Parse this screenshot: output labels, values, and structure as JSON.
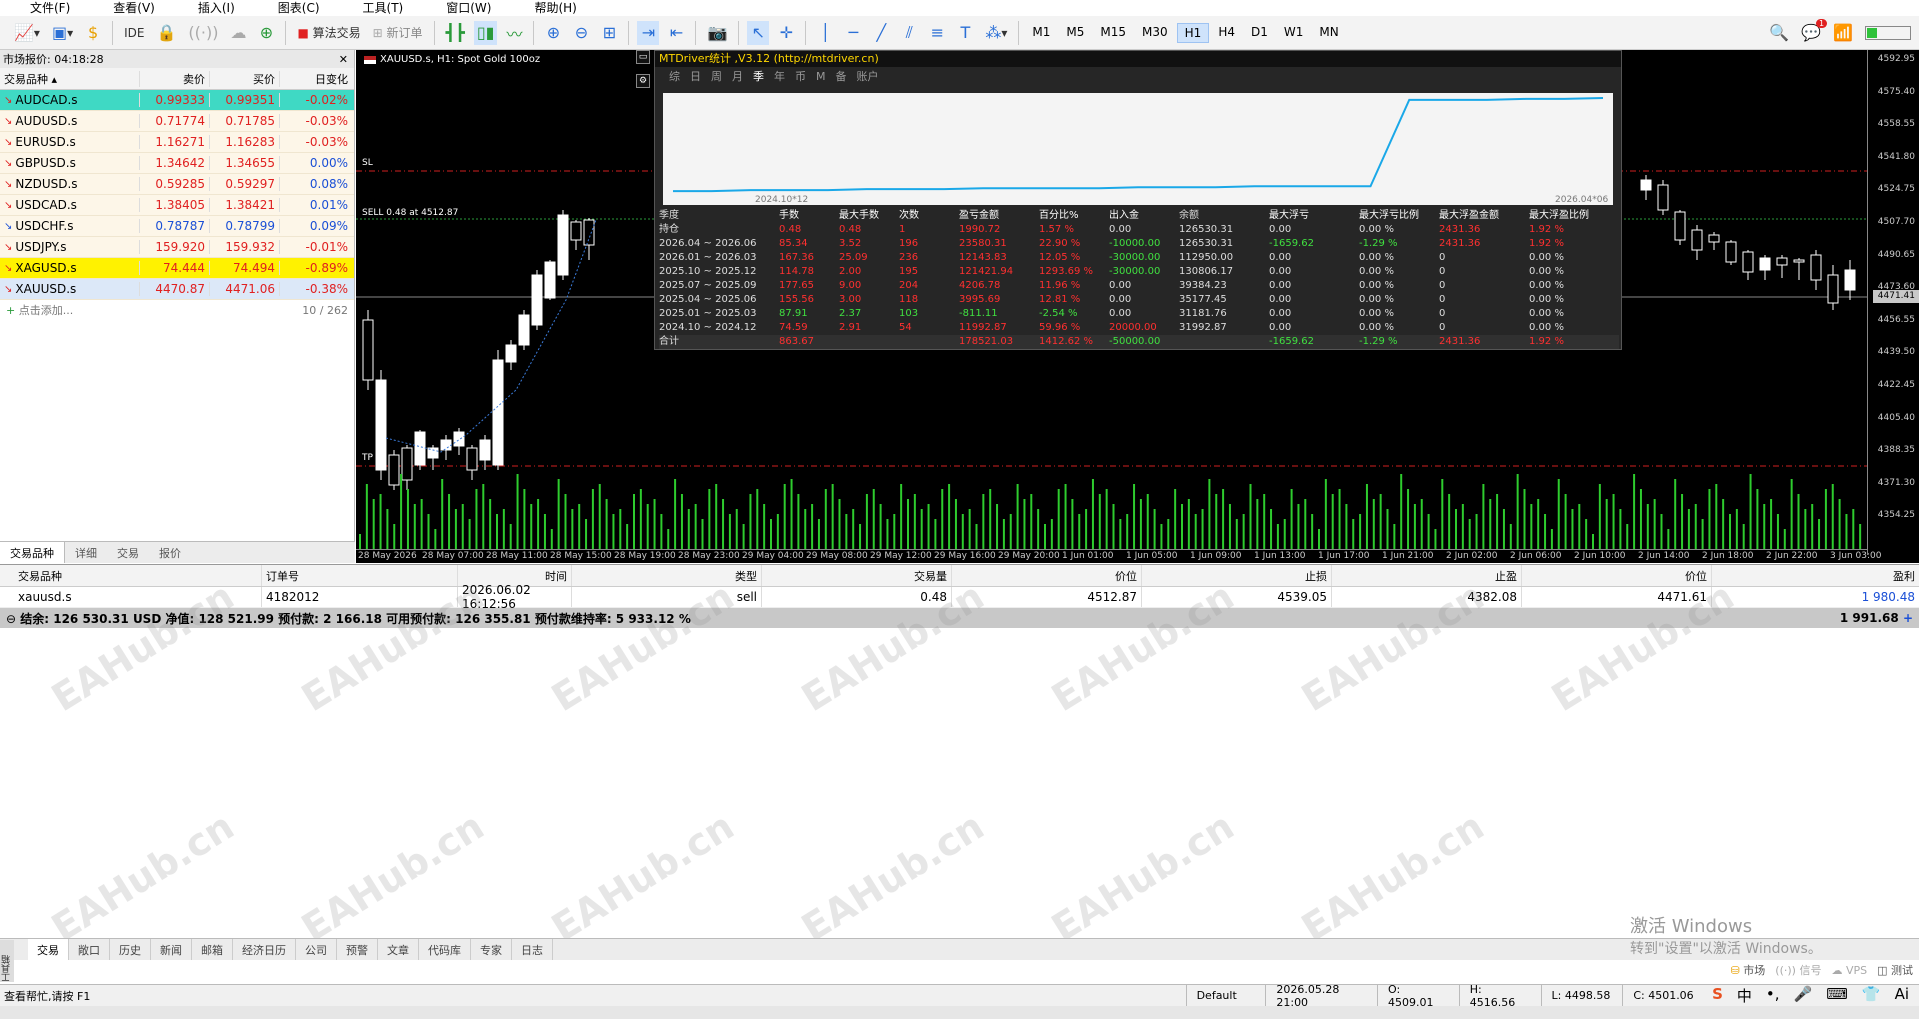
{
  "menu": [
    "文件(F)",
    "查看(V)",
    "插入(I)",
    "图表(C)",
    "工具(T)",
    "窗口(W)",
    "帮助(H)"
  ],
  "toolbar": {
    "ide": "IDE",
    "algo": "算法交易",
    "new_order": "新订单",
    "timeframes": [
      "M1",
      "M5",
      "M15",
      "M30",
      "H1",
      "H4",
      "D1",
      "W1",
      "MN"
    ],
    "active_tf": "H1"
  },
  "market_watch": {
    "title": "市场报价: 04:18:28",
    "cols": [
      "交易品种",
      "卖价",
      "买价",
      "日变化"
    ],
    "rows": [
      {
        "sym": "AUDCAD.s",
        "bid": "0.99333",
        "ask": "0.99351",
        "chg": "-0.02%",
        "dir": "dn",
        "sel": "sel1"
      },
      {
        "sym": "AUDUSD.s",
        "bid": "0.71774",
        "ask": "0.71785",
        "chg": "-0.03%",
        "dir": "dn",
        "sel": ""
      },
      {
        "sym": "EURUSD.s",
        "bid": "1.16271",
        "ask": "1.16283",
        "chg": "-0.03%",
        "dir": "dn",
        "sel": ""
      },
      {
        "sym": "GBPUSD.s",
        "bid": "1.34642",
        "ask": "1.34655",
        "chg": "0.00%",
        "dir": "dn",
        "sel": ""
      },
      {
        "sym": "NZDUSD.s",
        "bid": "0.59285",
        "ask": "0.59297",
        "chg": "0.08%",
        "dir": "dn",
        "sel": ""
      },
      {
        "sym": "USDCAD.s",
        "bid": "1.38405",
        "ask": "1.38421",
        "chg": "0.01%",
        "dir": "dn",
        "sel": ""
      },
      {
        "sym": "USDCHF.s",
        "bid": "0.78787",
        "ask": "0.78799",
        "chg": "0.09%",
        "dir": "up",
        "sel": ""
      },
      {
        "sym": "USDJPY.s",
        "bid": "159.920",
        "ask": "159.932",
        "chg": "-0.01%",
        "dir": "dn",
        "sel": ""
      },
      {
        "sym": "XAGUSD.s",
        "bid": "74.444",
        "ask": "74.494",
        "chg": "-0.89%",
        "dir": "dn",
        "sel": "sel2"
      },
      {
        "sym": "XAUUSD.s",
        "bid": "4470.87",
        "ask": "4471.06",
        "chg": "-0.38%",
        "dir": "dn",
        "sel": "sel3"
      }
    ],
    "add": "点击添加...",
    "count": "10 / 262",
    "tabs": [
      "交易品种",
      "详细",
      "交易",
      "报价"
    ]
  },
  "chart": {
    "title": "XAUUSD.s, H1:  Spot Gold 100oz",
    "sl_label": "SL",
    "tp_label": "TP",
    "sell_label": "SELL 0.48 at 4512.87",
    "y_labels": [
      "4592.95",
      "4575.40",
      "4558.55",
      "4541.80",
      "4524.75",
      "4507.70",
      "4490.65",
      "4473.60",
      "4456.55",
      "4439.50",
      "4422.45",
      "4405.40",
      "4388.35",
      "4371.30",
      "4354.25"
    ],
    "current_price": "4471.41",
    "x_labels": [
      "28 May 2026",
      "28 May 07:00",
      "28 May 11:00",
      "28 May 15:00",
      "28 May 19:00",
      "28 May 23:00",
      "29 May 04:00",
      "29 May 08:00",
      "29 May 12:00",
      "29 May 16:00",
      "29 May 20:00",
      "1 Jun 01:00",
      "1 Jun 05:00",
      "1 Jun 09:00",
      "1 Jun 13:00",
      "1 Jun 17:00",
      "1 Jun 21:00",
      "2 Jun 02:00",
      "2 Jun 06:00",
      "2 Jun 10:00",
      "2 Jun 14:00",
      "2 Jun 18:00",
      "2 Jun 22:00",
      "3 Jun 03:00"
    ]
  },
  "mtd": {
    "title": "MTDriver统计 ,V3.12 (http://mtdriver.cn)",
    "tabs": [
      "综",
      "日",
      "周",
      "月",
      "季",
      "年",
      "币",
      "M",
      "备",
      "账户"
    ],
    "active_tab": "季",
    "date_start": "2024.10*12",
    "date_end": "2026.04*06",
    "headers": [
      "季度",
      "手数",
      "最大手数",
      "次数",
      "盈亏金额",
      "百分比%",
      "出入金",
      "余额",
      "最大浮亏",
      "最大浮亏比例",
      "最大浮盈金额",
      "最大浮盈比例"
    ],
    "rows": [
      [
        "持仓",
        "0.48",
        "0.48",
        "1",
        "1990.72",
        "1.57 %",
        "0.00",
        "126530.31",
        "0.00",
        "0.00 %",
        "2431.36",
        "1.92 %"
      ],
      [
        "2026.04 ~ 2026.06",
        "85.34",
        "3.52",
        "196",
        "23580.31",
        "22.90 %",
        "-10000.00",
        "126530.31",
        "-1659.62",
        "-1.29 %",
        "2431.36",
        "1.92 %"
      ],
      [
        "2026.01 ~ 2026.03",
        "167.36",
        "25.09",
        "236",
        "12143.83",
        "12.05 %",
        "-30000.00",
        "112950.00",
        "0.00",
        "0.00 %",
        "0",
        "0.00 %"
      ],
      [
        "2025.10 ~ 2025.12",
        "114.78",
        "2.00",
        "195",
        "121421.94",
        "1293.69 %",
        "-30000.00",
        "130806.17",
        "0.00",
        "0.00 %",
        "0",
        "0.00 %"
      ],
      [
        "2025.07 ~ 2025.09",
        "177.65",
        "9.00",
        "204",
        "4206.78",
        "11.96 %",
        "0.00",
        "39384.23",
        "0.00",
        "0.00 %",
        "0",
        "0.00 %"
      ],
      [
        "2025.04 ~ 2025.06",
        "155.56",
        "3.00",
        "118",
        "3995.69",
        "12.81 %",
        "0.00",
        "35177.45",
        "0.00",
        "0.00 %",
        "0",
        "0.00 %"
      ],
      [
        "2025.01 ~ 2025.03",
        "87.91",
        "2.37",
        "103",
        "-811.11",
        "-2.54 %",
        "0.00",
        "31181.76",
        "0.00",
        "0.00 %",
        "0",
        "0.00 %"
      ],
      [
        "2024.10 ~ 2024.12",
        "74.59",
        "2.91",
        "54",
        "11992.87",
        "59.96 %",
        "20000.00",
        "31992.87",
        "0.00",
        "0.00 %",
        "0",
        "0.00 %"
      ]
    ],
    "total": [
      "合计",
      "863.67",
      "",
      "",
      "178521.03",
      "1412.62 %",
      "-50000.00",
      "",
      "-1659.62",
      "-1.29 %",
      "2431.36",
      "1.92 %"
    ],
    "equity_curve": [
      0.02,
      0.02,
      0.03,
      0.03,
      0.03,
      0.04,
      0.04,
      0.04,
      0.05,
      0.05,
      0.05,
      0.05,
      0.06,
      0.06,
      0.06,
      0.07,
      0.07,
      0.07,
      0.07,
      0.97,
      0.97,
      0.97,
      0.98,
      0.98,
      0.99
    ]
  },
  "orders": {
    "headers": [
      "交易品种",
      "订单号",
      "时间",
      "类型",
      "交易量",
      "价位",
      "止损",
      "止盈",
      "价位",
      "盈利"
    ],
    "row": [
      "xauusd.s",
      "4182012",
      "2026.06.02 16:12:56",
      "sell",
      "0.48",
      "4512.87",
      "4539.05",
      "4382.08",
      "4471.61",
      "1 980.48"
    ],
    "balance": "结余: 126 530.31 USD  净值: 128 521.99  预付款: 2 166.18  可用预付款: 126 355.81  预付款维持率: 5 933.12 %",
    "profit_total": "1 991.68",
    "tabs": [
      "交易",
      "敞口",
      "历史",
      "新闻",
      "邮箱",
      "经济日历",
      "公司",
      "预警",
      "文章",
      "代码库",
      "专家",
      "日志"
    ],
    "vtab": "工具箱"
  },
  "status": {
    "help": "查看帮忙,请按 F1",
    "profile": "Default",
    "time": "2026.05.28 21:00",
    "o": "O: 4509.01",
    "h": "H: 4516.56",
    "l": "L: 4498.58",
    "c": "C: 4501.06"
  },
  "win_activation": {
    "line1": "激活 Windows",
    "line2": "转到\"设置\"以激活 Windows。"
  },
  "watermark": "EAHub.cn",
  "tray": {
    "market": "市场",
    "signal": "信号",
    "vps": "VPS",
    "test": "测试"
  }
}
